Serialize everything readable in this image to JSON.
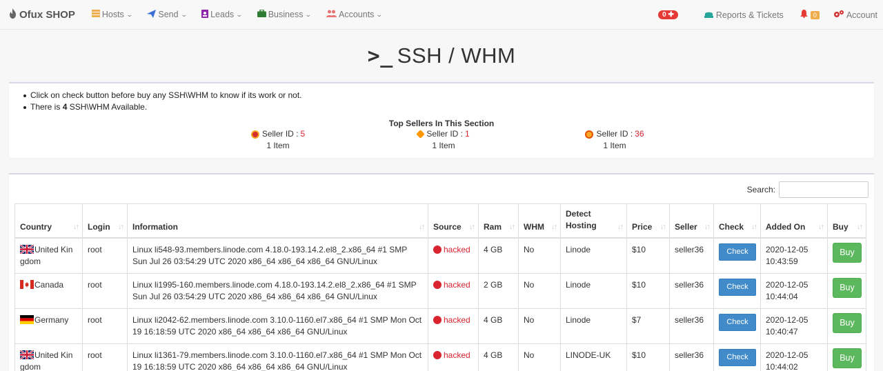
{
  "navbar": {
    "brand": "Ofux SHOP",
    "items": [
      {
        "label": "Hosts",
        "icon": "server-icon",
        "color": "#f0ad4e"
      },
      {
        "label": "Send",
        "icon": "paper-plane-icon",
        "color": "#3b6fd4"
      },
      {
        "label": "Leads",
        "icon": "address-book-icon",
        "color": "#8e24aa"
      },
      {
        "label": "Business",
        "icon": "briefcase-icon",
        "color": "#2e7d32"
      },
      {
        "label": "Accounts",
        "icon": "users-icon",
        "color": "#e57373"
      }
    ],
    "cart_badge": "0",
    "reports": "Reports & Tickets",
    "bell_count": "0",
    "account": "Account"
  },
  "page": {
    "title": "SSH / WHM",
    "prompt": ">_"
  },
  "info": {
    "bullet1": "Click on check button before buy any SSH\\WHM to know if its work or not.",
    "bullet2_pre": "There is ",
    "bullet2_count": "4",
    "bullet2_post": " SSH\\WHM Available.",
    "top_sellers_title": "Top Sellers In This Section",
    "sellers": [
      {
        "label": "Seller ID :",
        "id": "5",
        "items": "1 Item",
        "medal_color": "#d32f2f"
      },
      {
        "label": "Seller ID :",
        "id": "1",
        "items": "1 Item",
        "medal_color": "#ff9800"
      },
      {
        "label": "Seller ID :",
        "id": "36",
        "items": "1 Item",
        "medal_color": "#f9a825"
      }
    ]
  },
  "search": {
    "label": "Search:",
    "value": ""
  },
  "table": {
    "columns": [
      "Country",
      "Login",
      "Information",
      "Source",
      "Ram",
      "WHM",
      "Detect Hosting",
      "Price",
      "Seller",
      "Check",
      "Added On",
      "Buy"
    ],
    "rows": [
      {
        "flag": "uk",
        "country": "United Kingdom",
        "login": "root",
        "info": "Linux li548-93.members.linode.com 4.18.0-193.14.2.el8_2.x86_64 #1 SMP Sun Jul 26 03:54:29 UTC 2020 x86_64 x86_64 x86_64 GNU/Linux",
        "source": "hacked",
        "ram": "4 GB",
        "whm": "No",
        "hosting": "Linode",
        "price": "$10",
        "seller": "seller36",
        "check": "Check",
        "added": "2020-12-05 10:43:59",
        "buy": "Buy"
      },
      {
        "flag": "ca",
        "country": "Canada",
        "login": "root",
        "info": "Linux li1995-160.members.linode.com 4.18.0-193.14.2.el8_2.x86_64 #1 SMP Sun Jul 26 03:54:29 UTC 2020 x86_64 x86_64 x86_64 GNU/Linux",
        "source": "hacked",
        "ram": "2 GB",
        "whm": "No",
        "hosting": "Linode",
        "price": "$10",
        "seller": "seller36",
        "check": "Check",
        "added": "2020-12-05 10:44:04",
        "buy": "Buy"
      },
      {
        "flag": "de",
        "country": "Germany",
        "login": "root",
        "info": "Linux li2042-62.members.linode.com 3.10.0-1160.el7.x86_64 #1 SMP Mon Oct 19 16:18:59 UTC 2020 x86_64 x86_64 x86_64 GNU/Linux",
        "source": "hacked",
        "ram": "4 GB",
        "whm": "No",
        "hosting": "Linode",
        "price": "$7",
        "seller": "seller36",
        "check": "Check",
        "added": "2020-12-05 10:40:47",
        "buy": "Buy"
      },
      {
        "flag": "uk",
        "country": "United Kingdom",
        "login": "root",
        "info": "Linux li1361-79.members.linode.com 3.10.0-1160.el7.x86_64 #1 SMP Mon Oct 19 16:18:59 UTC 2020 x86_64 x86_64 x86_64 GNU/Linux",
        "source": "hacked",
        "ram": "4 GB",
        "whm": "No",
        "hosting": "LINODE-UK",
        "price": "$10",
        "seller": "seller36",
        "check": "Check",
        "added": "2020-12-05 10:44:02",
        "buy": "Buy"
      }
    ]
  }
}
